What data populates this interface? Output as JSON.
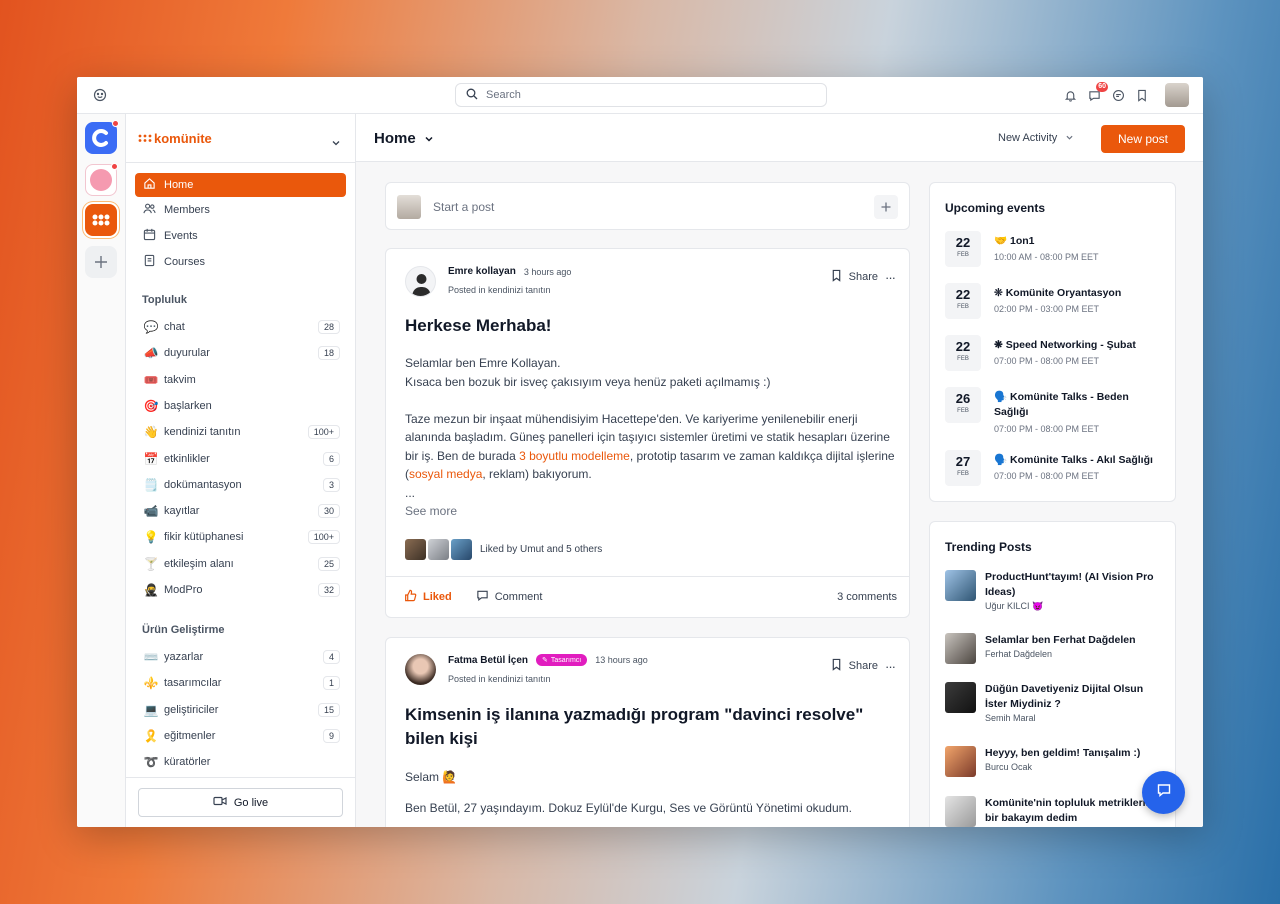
{
  "topbar": {
    "search_placeholder": "Search",
    "message_badge": "60"
  },
  "brand": {
    "name": "komünite"
  },
  "nav": [
    {
      "label": "Home"
    },
    {
      "label": "Members"
    },
    {
      "label": "Events"
    },
    {
      "label": "Courses"
    }
  ],
  "topluluk": {
    "title": "Topluluk",
    "channels": [
      {
        "emoji": "💬",
        "label": "chat",
        "count": "28"
      },
      {
        "emoji": "📣",
        "label": "duyurular",
        "count": "18"
      },
      {
        "emoji": "🎟️",
        "label": "takvim",
        "count": ""
      },
      {
        "emoji": "🎯",
        "label": "başlarken",
        "count": ""
      },
      {
        "emoji": "👋",
        "label": "kendinizi tanıtın",
        "count": "100+"
      },
      {
        "emoji": "📅",
        "label": "etkinlikler",
        "count": "6"
      },
      {
        "emoji": "🗒️",
        "label": "dokümantasyon",
        "count": "3"
      },
      {
        "emoji": "📹",
        "label": "kayıtlar",
        "count": "30"
      },
      {
        "emoji": "💡",
        "label": "fikir kütüphanesi",
        "count": "100+"
      },
      {
        "emoji": "🍸",
        "label": "etkileşim alanı",
        "count": "25"
      },
      {
        "emoji": "🥷",
        "label": "ModPro",
        "count": "32"
      }
    ]
  },
  "urun": {
    "title": "Ürün Geliştirme",
    "channels": [
      {
        "emoji": "⌨️",
        "label": "yazarlar",
        "count": "4"
      },
      {
        "emoji": "⚜️",
        "label": "tasarımcılar",
        "count": "1"
      },
      {
        "emoji": "💻",
        "label": "geliştiriciler",
        "count": "15"
      },
      {
        "emoji": "🎗️",
        "label": "eğitmenler",
        "count": "9"
      },
      {
        "emoji": "➰",
        "label": "küratörler",
        "count": ""
      }
    ]
  },
  "golive": "Go live",
  "header": {
    "title": "Home",
    "new_activity": "New Activity",
    "new_post": "New post"
  },
  "compose": {
    "placeholder": "Start a post"
  },
  "post1": {
    "author": "Emre kollayan",
    "time": "3 hours ago",
    "posted_in": "Posted in kendinizi tanıtın",
    "title": "Herkese Merhaba!",
    "p1": "Selamlar ben Emre Kollayan.",
    "p2": "Kısaca ben bozuk bir isveç çakısıyım veya henüz paketi açılmamış :)",
    "p3a": "Taze mezun bir inşaat mühendisiyim Hacettepe'den. Ve kariyerime yenilenebilir enerji alanında başladım. Güneş panelleri için taşıyıcı sistemler üretimi ve statik hesapları üzerine bir iş. Ben de burada ",
    "p3link1": "3 boyutlu modelleme",
    "p3b": ", prototip tasarım ve zaman kaldıkça dijital işlerine (",
    "p3link2": "sosyal medya",
    "p3c": ", reklam) bakıyorum.",
    "ellipsis": "...",
    "see_more": "See more",
    "liked_by": "Liked by Umut and 5 others",
    "share": "Share",
    "liked": "Liked",
    "comment": "Comment",
    "comments": "3 comments"
  },
  "post2": {
    "author": "Fatma Betül İçen",
    "tag": "Tasarımcı",
    "time": "13 hours ago",
    "posted_in": "Posted in kendinizi tanıtın",
    "title": "Kimsenin iş ilanına yazmadığı program \"davinci resolve\" bilen kişi",
    "greeting": "Selam 🙋",
    "p1": "Ben Betül, 27 yaşındayım. Dokuz Eylül'de Kurgu, Ses ve Görüntü Yönetimi okudum.",
    "share": "Share"
  },
  "events": {
    "title": "Upcoming events",
    "items": [
      {
        "day": "22",
        "month": "FEB",
        "title": "🤝 1on1",
        "time": "10:00 AM - 08:00 PM EET"
      },
      {
        "day": "22",
        "month": "FEB",
        "title": "❊ Komünite Oryantasyon",
        "time": "02:00 PM - 03:00 PM EET"
      },
      {
        "day": "22",
        "month": "FEB",
        "title": "❋ Speed Networking - Şubat",
        "time": "07:00 PM - 08:00 PM EET"
      },
      {
        "day": "26",
        "month": "FEB",
        "title": "🗣️ Komünite Talks - Beden Sağlığı",
        "time": "07:00 PM - 08:00 PM EET"
      },
      {
        "day": "27",
        "month": "FEB",
        "title": "🗣️ Komünite Talks - Akıl Sağlığı",
        "time": "07:00 PM - 08:00 PM EET"
      }
    ]
  },
  "trending": {
    "title": "Trending Posts",
    "items": [
      {
        "title": "ProductHunt'tayım! (AI Vision Pro Ideas)",
        "author": "Uğur KILCI 😈"
      },
      {
        "title": "Selamlar ben Ferhat Dağdelen",
        "author": "Ferhat Dağdelen"
      },
      {
        "title": "Düğün Davetiyeniz Dijital Olsun İster Miydiniz ?",
        "author": "Semih Maral"
      },
      {
        "title": "Heyyy, ben geldim! Tanışalım :)",
        "author": "Burcu Ocak"
      },
      {
        "title": "Komünite'nin topluluk metriklerine bir bakayım dedim",
        "author": ""
      }
    ]
  }
}
